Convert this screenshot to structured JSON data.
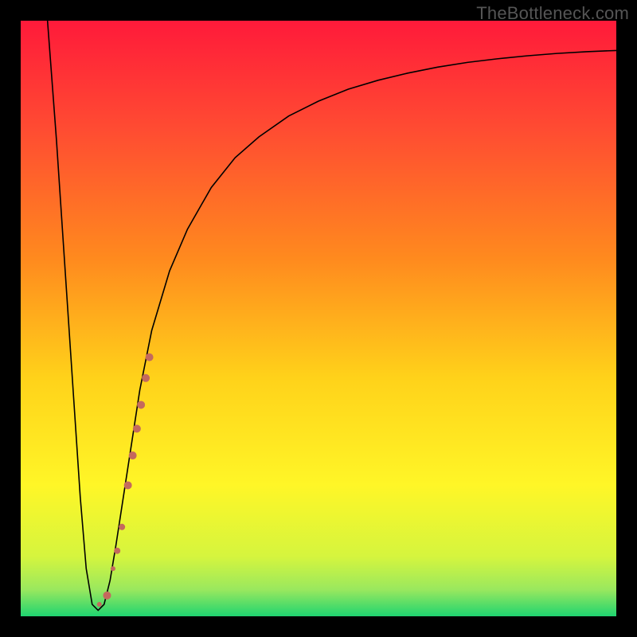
{
  "watermark": "TheBottleneck.com",
  "chart_data": {
    "type": "line",
    "title": "",
    "xlabel": "",
    "ylabel": "",
    "xlim": [
      0,
      100
    ],
    "ylim": [
      0,
      100
    ],
    "grid": false,
    "legend": false,
    "background_gradient": {
      "stops": [
        {
          "pos": 0.0,
          "color": "#ff1a3a"
        },
        {
          "pos": 0.18,
          "color": "#ff4b32"
        },
        {
          "pos": 0.4,
          "color": "#ff8a1e"
        },
        {
          "pos": 0.6,
          "color": "#ffd21a"
        },
        {
          "pos": 0.78,
          "color": "#fff627"
        },
        {
          "pos": 0.9,
          "color": "#d5f53e"
        },
        {
          "pos": 0.955,
          "color": "#9ae85e"
        },
        {
          "pos": 1.0,
          "color": "#1fd470"
        }
      ]
    },
    "series": [
      {
        "name": "bottleneck-curve",
        "x": [
          4.5,
          6,
          8,
          10,
          11,
          12,
          13,
          14,
          15,
          16,
          18,
          20,
          22,
          25,
          28,
          32,
          36,
          40,
          45,
          50,
          55,
          60,
          65,
          70,
          75,
          80,
          85,
          90,
          95,
          100
        ],
        "y": [
          100,
          80,
          50,
          20,
          8,
          2,
          1,
          2,
          6,
          12,
          25,
          38,
          48,
          58,
          65,
          72,
          77,
          80.5,
          84,
          86.5,
          88.5,
          90,
          91.2,
          92.2,
          93,
          93.6,
          94.1,
          94.5,
          94.8,
          95
        ]
      }
    ],
    "scatter": {
      "name": "sample-points",
      "color": "#c46a5d",
      "points": [
        {
          "x": 13.2,
          "y": 2.0,
          "r": 3
        },
        {
          "x": 14.5,
          "y": 3.5,
          "r": 5
        },
        {
          "x": 15.5,
          "y": 8.0,
          "r": 3
        },
        {
          "x": 16.2,
          "y": 11.0,
          "r": 4
        },
        {
          "x": 17.0,
          "y": 15.0,
          "r": 4
        },
        {
          "x": 18.0,
          "y": 22.0,
          "r": 5
        },
        {
          "x": 18.8,
          "y": 27.0,
          "r": 5
        },
        {
          "x": 19.5,
          "y": 31.5,
          "r": 5
        },
        {
          "x": 20.2,
          "y": 35.5,
          "r": 5
        },
        {
          "x": 21.0,
          "y": 40.0,
          "r": 5
        },
        {
          "x": 21.6,
          "y": 43.5,
          "r": 5
        }
      ]
    }
  }
}
